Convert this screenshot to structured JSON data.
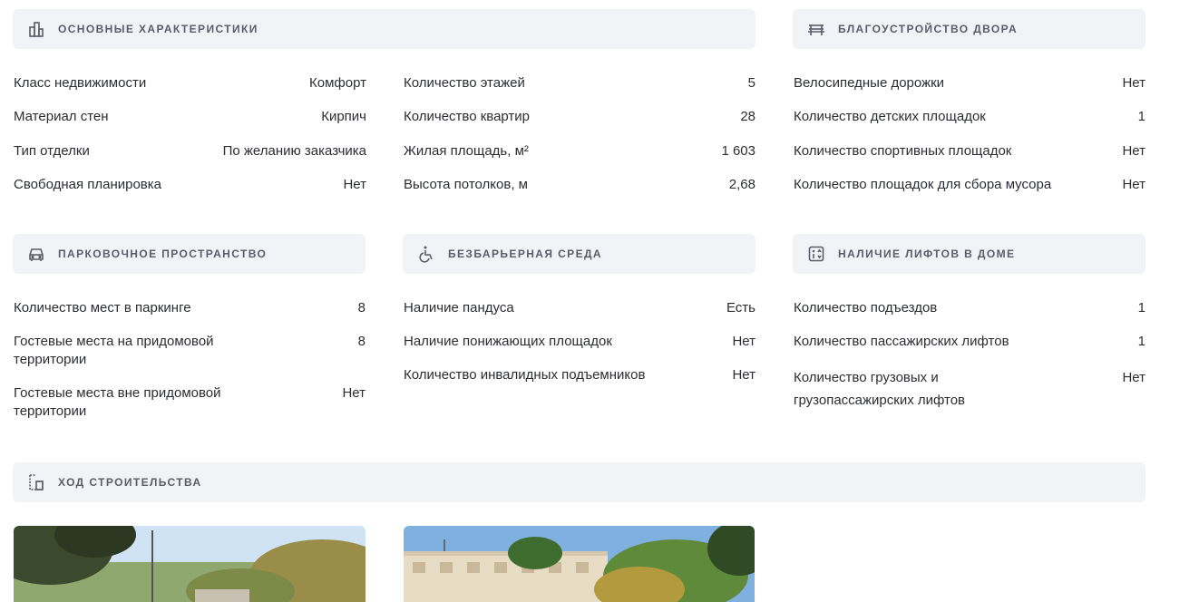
{
  "sections": {
    "main": {
      "title": "Основные характеристики",
      "icon": "building-icon",
      "col1": [
        {
          "label": "Класс недвижимости",
          "value": "Комфорт"
        },
        {
          "label": "Материал стен",
          "value": "Кирпич"
        },
        {
          "label": "Тип отделки",
          "value": "По желанию заказчика"
        },
        {
          "label": "Свободная планировка",
          "value": "Нет"
        }
      ],
      "col2": [
        {
          "label": "Количество этажей",
          "value": "5"
        },
        {
          "label": "Количество квартир",
          "value": "28"
        },
        {
          "label": "Жилая площадь, м²",
          "value": "1 603"
        },
        {
          "label": "Высота потолков, м",
          "value": "2,68"
        }
      ]
    },
    "yard": {
      "title": "Благоустройство двора",
      "icon": "bench-icon",
      "rows": [
        {
          "label": "Велосипедные дорожки",
          "value": "Нет"
        },
        {
          "label": "Количество детских площадок",
          "value": "1"
        },
        {
          "label": "Количество спортивных площадок",
          "value": "Нет"
        },
        {
          "label": "Количество площадок для сбора мусора",
          "value": "Нет"
        }
      ]
    },
    "parking": {
      "title": "Парковочное пространство",
      "icon": "car-icon",
      "rows": [
        {
          "label": "Количество мест в паркинге",
          "value": "8"
        },
        {
          "label": "Гостевые места на придомовой территории",
          "value": "8"
        },
        {
          "label": "Гостевые места вне придомовой территории",
          "value": "Нет"
        }
      ]
    },
    "accessible": {
      "title": "Безбарьерная среда",
      "icon": "wheelchair-icon",
      "rows": [
        {
          "label": "Наличие пандуса",
          "value": "Есть"
        },
        {
          "label": "Наличие понижающих площадок",
          "value": "Нет"
        },
        {
          "label": "Количество инвалидных подъемников",
          "value": "Нет"
        }
      ]
    },
    "lifts": {
      "title": "Наличие лифтов в доме",
      "icon": "elevator-icon",
      "rows": [
        {
          "label": "Количество подъездов",
          "value": "1"
        },
        {
          "label": "Количество пассажирских лифтов",
          "value": "1"
        },
        {
          "label": "Количество грузовых и грузопассажирских лифтов",
          "value": "Нет"
        }
      ]
    },
    "construction": {
      "title": "Ход строительства",
      "icon": "construction-icon"
    }
  },
  "colors": {
    "header_bg": "#f2f3f7",
    "header_text": "#5a5d66",
    "text": "#2b2d33"
  }
}
